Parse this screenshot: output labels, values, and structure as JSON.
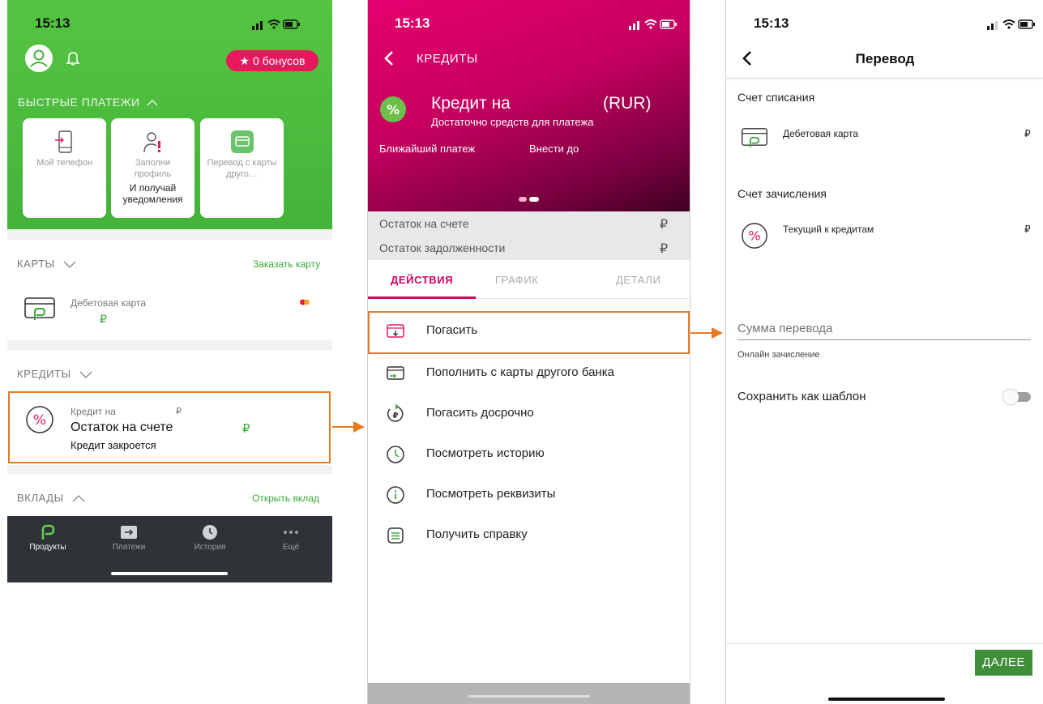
{
  "colors": {
    "green": "#4cbb3e",
    "magenta": "#e6006f",
    "accent_orange": "#e87a22",
    "pink_badge": "#e6195d",
    "dark_nav": "#2f3338",
    "button_green": "#3e8e3a"
  },
  "screen1": {
    "time": "15:13",
    "bonus_label": "★ 0 бонусов",
    "quick_payments_title": "БЫСТРЫЕ ПЛАТЕЖИ",
    "quick_cards": [
      {
        "label": "Мой телефон",
        "icon": "phone-icon"
      },
      {
        "label": "Заполни профиль",
        "sub": "И получай уведомления",
        "icon": "profile-icon"
      },
      {
        "label": "Перевод с карты друго…",
        "icon": "card-transfer-icon"
      }
    ],
    "cards_section": {
      "title": "КАРТЫ",
      "order_link": "Заказать карту",
      "card_name": "Дебетовая карта",
      "currency": "₽"
    },
    "credits_section": {
      "title": "КРЕДИТЫ",
      "credit_title": "Кредит на",
      "credit_currency": "₽",
      "balance_label": "Остаток на счете",
      "balance_currency": "₽",
      "closing_note": "Кредит закроется"
    },
    "deposits_section": {
      "title": "ВКЛАДЫ",
      "open_link": "Открыть вклад"
    },
    "nav": [
      {
        "label": "Продукты",
        "icon": "products-icon"
      },
      {
        "label": "Платежи",
        "icon": "payments-icon"
      },
      {
        "label": "История",
        "icon": "history-icon"
      },
      {
        "label": "Ещё",
        "icon": "more-icon"
      }
    ]
  },
  "screen2": {
    "time": "15:13",
    "back_title": "КРЕДИТЫ",
    "credit_title": "Кредит на",
    "currency_code": "(RUR)",
    "sufficient_funds": "Достаточно средств для платежа",
    "next_payment_label": "Ближайший платеж",
    "pay_until_label": "Внести до",
    "balance_rows": [
      {
        "label": "Остаток на счете",
        "currency": "₽"
      },
      {
        "label": "Остаток задолженности",
        "currency": "₽"
      }
    ],
    "tabs": [
      "ДЕЙСТВИЯ",
      "ГРАФИК",
      "ДЕТАЛИ"
    ],
    "actions": [
      {
        "label": "Погасить",
        "icon": "repay-icon"
      },
      {
        "label": "Пополнить с карты другого банка",
        "icon": "topup-card-icon"
      },
      {
        "label": "Погасить досрочно",
        "icon": "early-repay-icon"
      },
      {
        "label": "Посмотреть историю",
        "icon": "clock-icon"
      },
      {
        "label": "Посмотреть реквизиты",
        "icon": "info-icon"
      },
      {
        "label": "Получить справку",
        "icon": "document-icon"
      }
    ]
  },
  "screen3": {
    "time": "15:13",
    "title": "Перевод",
    "debit_account_label": "Счет списания",
    "debit_card_name": "Дебетовая карта",
    "debit_currency": "₽",
    "credit_account_label": "Счет зачисления",
    "credit_account_name": "Текущий к кредитам",
    "credit_currency": "₽",
    "amount_placeholder": "Сумма перевода",
    "online_note": "Онлайн зачисление",
    "save_template_label": "Сохранить как шаблон",
    "next_button": "ДАЛЕЕ"
  }
}
